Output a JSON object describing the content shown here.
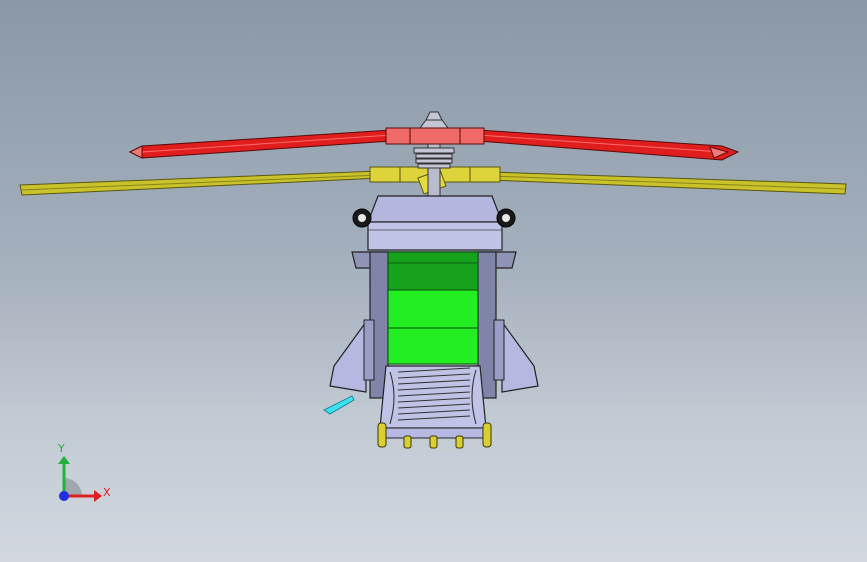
{
  "viewport": {
    "background_top": "#8a98a8",
    "background_bottom": "#d2d8de"
  },
  "model": {
    "upper_rotor_color": "#e51d1d",
    "lower_rotor_color": "#c8c020",
    "cabin_glass_color": "#22ee22",
    "body_color": "#b6b8e2"
  },
  "triad": {
    "x_label": "X",
    "y_label": "Y",
    "x_color": "#e02020",
    "y_color": "#20b040",
    "z_color": "#2030e0"
  }
}
